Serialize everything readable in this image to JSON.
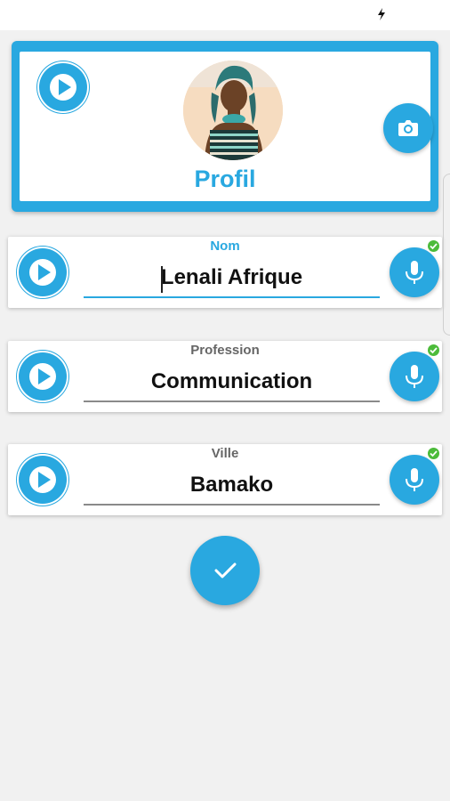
{
  "theme": {
    "accent": "#29a8e0",
    "check": "#4cbb3a",
    "background": "#f1f1f1"
  },
  "status_bar": {
    "icon": "lightning-charge-icon"
  },
  "profile": {
    "title": "Profil",
    "play_icon": "play-icon",
    "camera_icon": "camera-icon",
    "avatar": "profile-photo"
  },
  "fields": [
    {
      "label": "Nom",
      "value": "Lenali Afrique",
      "active": true,
      "play_icon": "play-icon",
      "mic_icon": "microphone-icon",
      "status_icon": "check-icon"
    },
    {
      "label": "Profession",
      "value": "Communication",
      "active": false,
      "play_icon": "play-icon",
      "mic_icon": "microphone-icon",
      "status_icon": "check-icon"
    },
    {
      "label": "Ville",
      "value": "Bamako",
      "active": false,
      "play_icon": "play-icon",
      "mic_icon": "microphone-icon",
      "status_icon": "check-icon"
    }
  ],
  "confirm": {
    "icon": "checkmark-icon"
  }
}
